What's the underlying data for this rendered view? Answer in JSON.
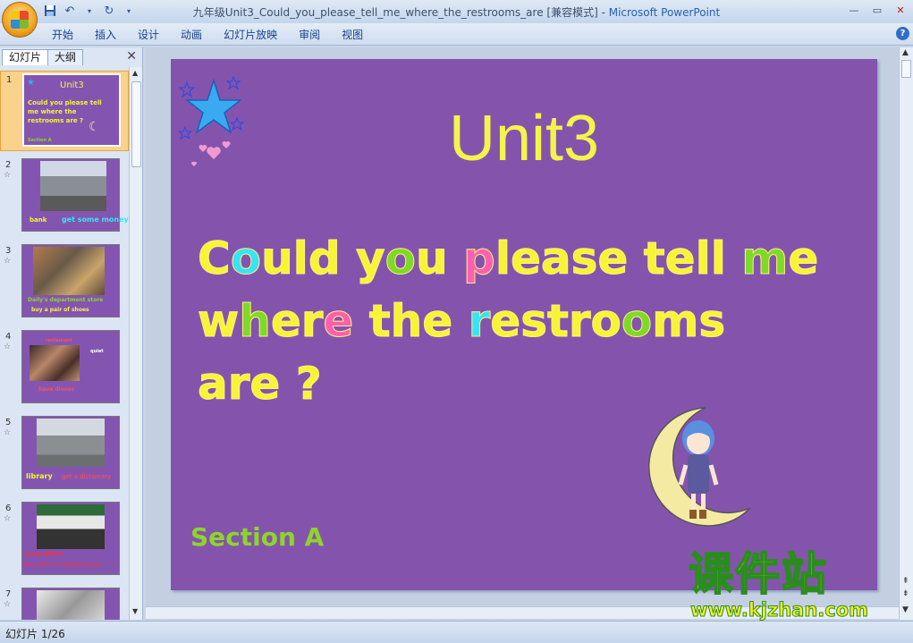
{
  "window": {
    "title": "九年级Unit3_Could_you_please_tell_me_where_the_restrooms_are [兼容模式] - ",
    "app_name": "Microsoft PowerPoint",
    "controls": [
      "—",
      "▭",
      "✕"
    ]
  },
  "quick_access": [
    "save-icon",
    "undo-icon",
    "redo-icon",
    "customize-icon"
  ],
  "ribbon": {
    "tabs": [
      "开始",
      "插入",
      "设计",
      "动画",
      "幻灯片放映",
      "审阅",
      "视图"
    ],
    "help": "?"
  },
  "left_panel": {
    "tabs": [
      "幻灯片",
      "大纲"
    ],
    "close": "✕",
    "thumbnails": [
      {
        "number": "1",
        "title": "Unit3",
        "text": "Could you please tell me where the restrooms are ?",
        "footer": "Section A"
      },
      {
        "number": "2",
        "captions": [
          "bank",
          "get some money"
        ]
      },
      {
        "number": "3",
        "captions": [
          "Daily's department store",
          "buy a pair of shoes"
        ]
      },
      {
        "number": "4",
        "captions": [
          "restaurant",
          "quiet",
          "have dinner"
        ]
      },
      {
        "number": "5",
        "captions": [
          "library",
          "get a dictionary"
        ]
      },
      {
        "number": "6",
        "captions": [
          "post office",
          "buy some stamps/newspaper"
        ]
      },
      {
        "number": "7",
        "captions": []
      }
    ]
  },
  "slide": {
    "title": "Unit3",
    "body_lines": [
      "Could you please tell me",
      "where the restrooms",
      "are ?"
    ],
    "section": "Section A"
  },
  "watermark": {
    "chinese": "课件站",
    "url": "www.kjzhan.com"
  },
  "status": {
    "slide_indicator": "幻灯片 1/26"
  },
  "colors": {
    "slide_bg": "#8454ad",
    "title_yellow": "#f4f44a",
    "section_green": "#8ed42c",
    "selected_thumb": "#fbd28b"
  }
}
